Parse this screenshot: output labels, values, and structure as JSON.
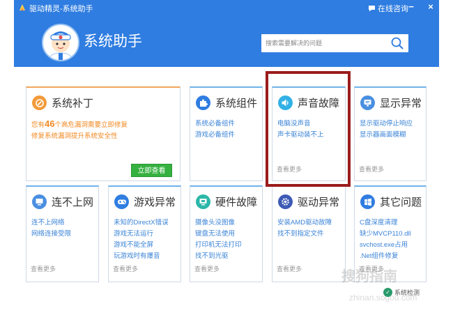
{
  "window": {
    "title": "驱动精灵-系统助手",
    "consult_label": "在线咨询",
    "minimize_glyph": "−",
    "close_glyph": "×"
  },
  "header": {
    "page_title": "系统助手",
    "search_placeholder": "搜索需要解决的问题"
  },
  "cards": {
    "patch": {
      "title": "系统补丁",
      "line1_prefix": "您有",
      "line1_count": "46",
      "line1_suffix": "个高危漏洞需要立即修复",
      "line2": "修复系统漏洞提升系统安全性",
      "button": "立即查看",
      "icon": "patch-icon",
      "accent": "#f29b3a"
    },
    "components": {
      "title": "系统组件",
      "links": [
        "系统必备组件",
        "游戏必备组件"
      ],
      "icon": "puzzle-icon",
      "accent": "#2f7de1"
    },
    "sound": {
      "title": "声音故障",
      "links": [
        "电脑没声音",
        "声卡驱动装不上"
      ],
      "more": "查看更多",
      "icon": "speaker-icon",
      "accent": "#33b1e6"
    },
    "display": {
      "title": "显示异常",
      "links": [
        "显示驱动停止响应",
        "显示器画面模糊"
      ],
      "more": "查看更多",
      "icon": "monitor-icon",
      "accent": "#4a8fe0"
    },
    "network": {
      "title": "连不上网",
      "links": [
        "连不上网络",
        "网络连接受限"
      ],
      "more": "查看更多",
      "icon": "network-icon",
      "accent": "#4a8fe0"
    },
    "game": {
      "title": "游戏异常",
      "links": [
        "未知的DirectX错误",
        "游戏无法运行",
        "游戏不能全屏",
        "玩游戏时有爆音"
      ],
      "more": "查看更多",
      "icon": "gamepad-icon",
      "accent": "#2f7de1"
    },
    "hardware": {
      "title": "硬件故障",
      "links": [
        "摄像头没图像",
        "键盘无法使用",
        "打印机无法打印",
        "找不到光驱"
      ],
      "more": "查看更多",
      "icon": "hardware-icon",
      "accent": "#2bb7a9"
    },
    "driver": {
      "title": "驱动异常",
      "links": [
        "安装AMD驱动故障",
        "找不到指定文件"
      ],
      "more": "查看更多",
      "icon": "gear-icon",
      "accent": "#3d5bb5"
    },
    "other": {
      "title": "其它问题",
      "links": [
        "C盘深度清理",
        "缺少MVCP110.dll",
        "svchost.exe占用",
        ".Net组件修复"
      ],
      "more": "查看更多",
      "icon": "windows-icon",
      "accent": "#2f7de1"
    }
  },
  "footer": {
    "system_check": "系统检测",
    "watermark_brand": "搜狗指南",
    "watermark_url": "zhinan.sogou.com"
  }
}
